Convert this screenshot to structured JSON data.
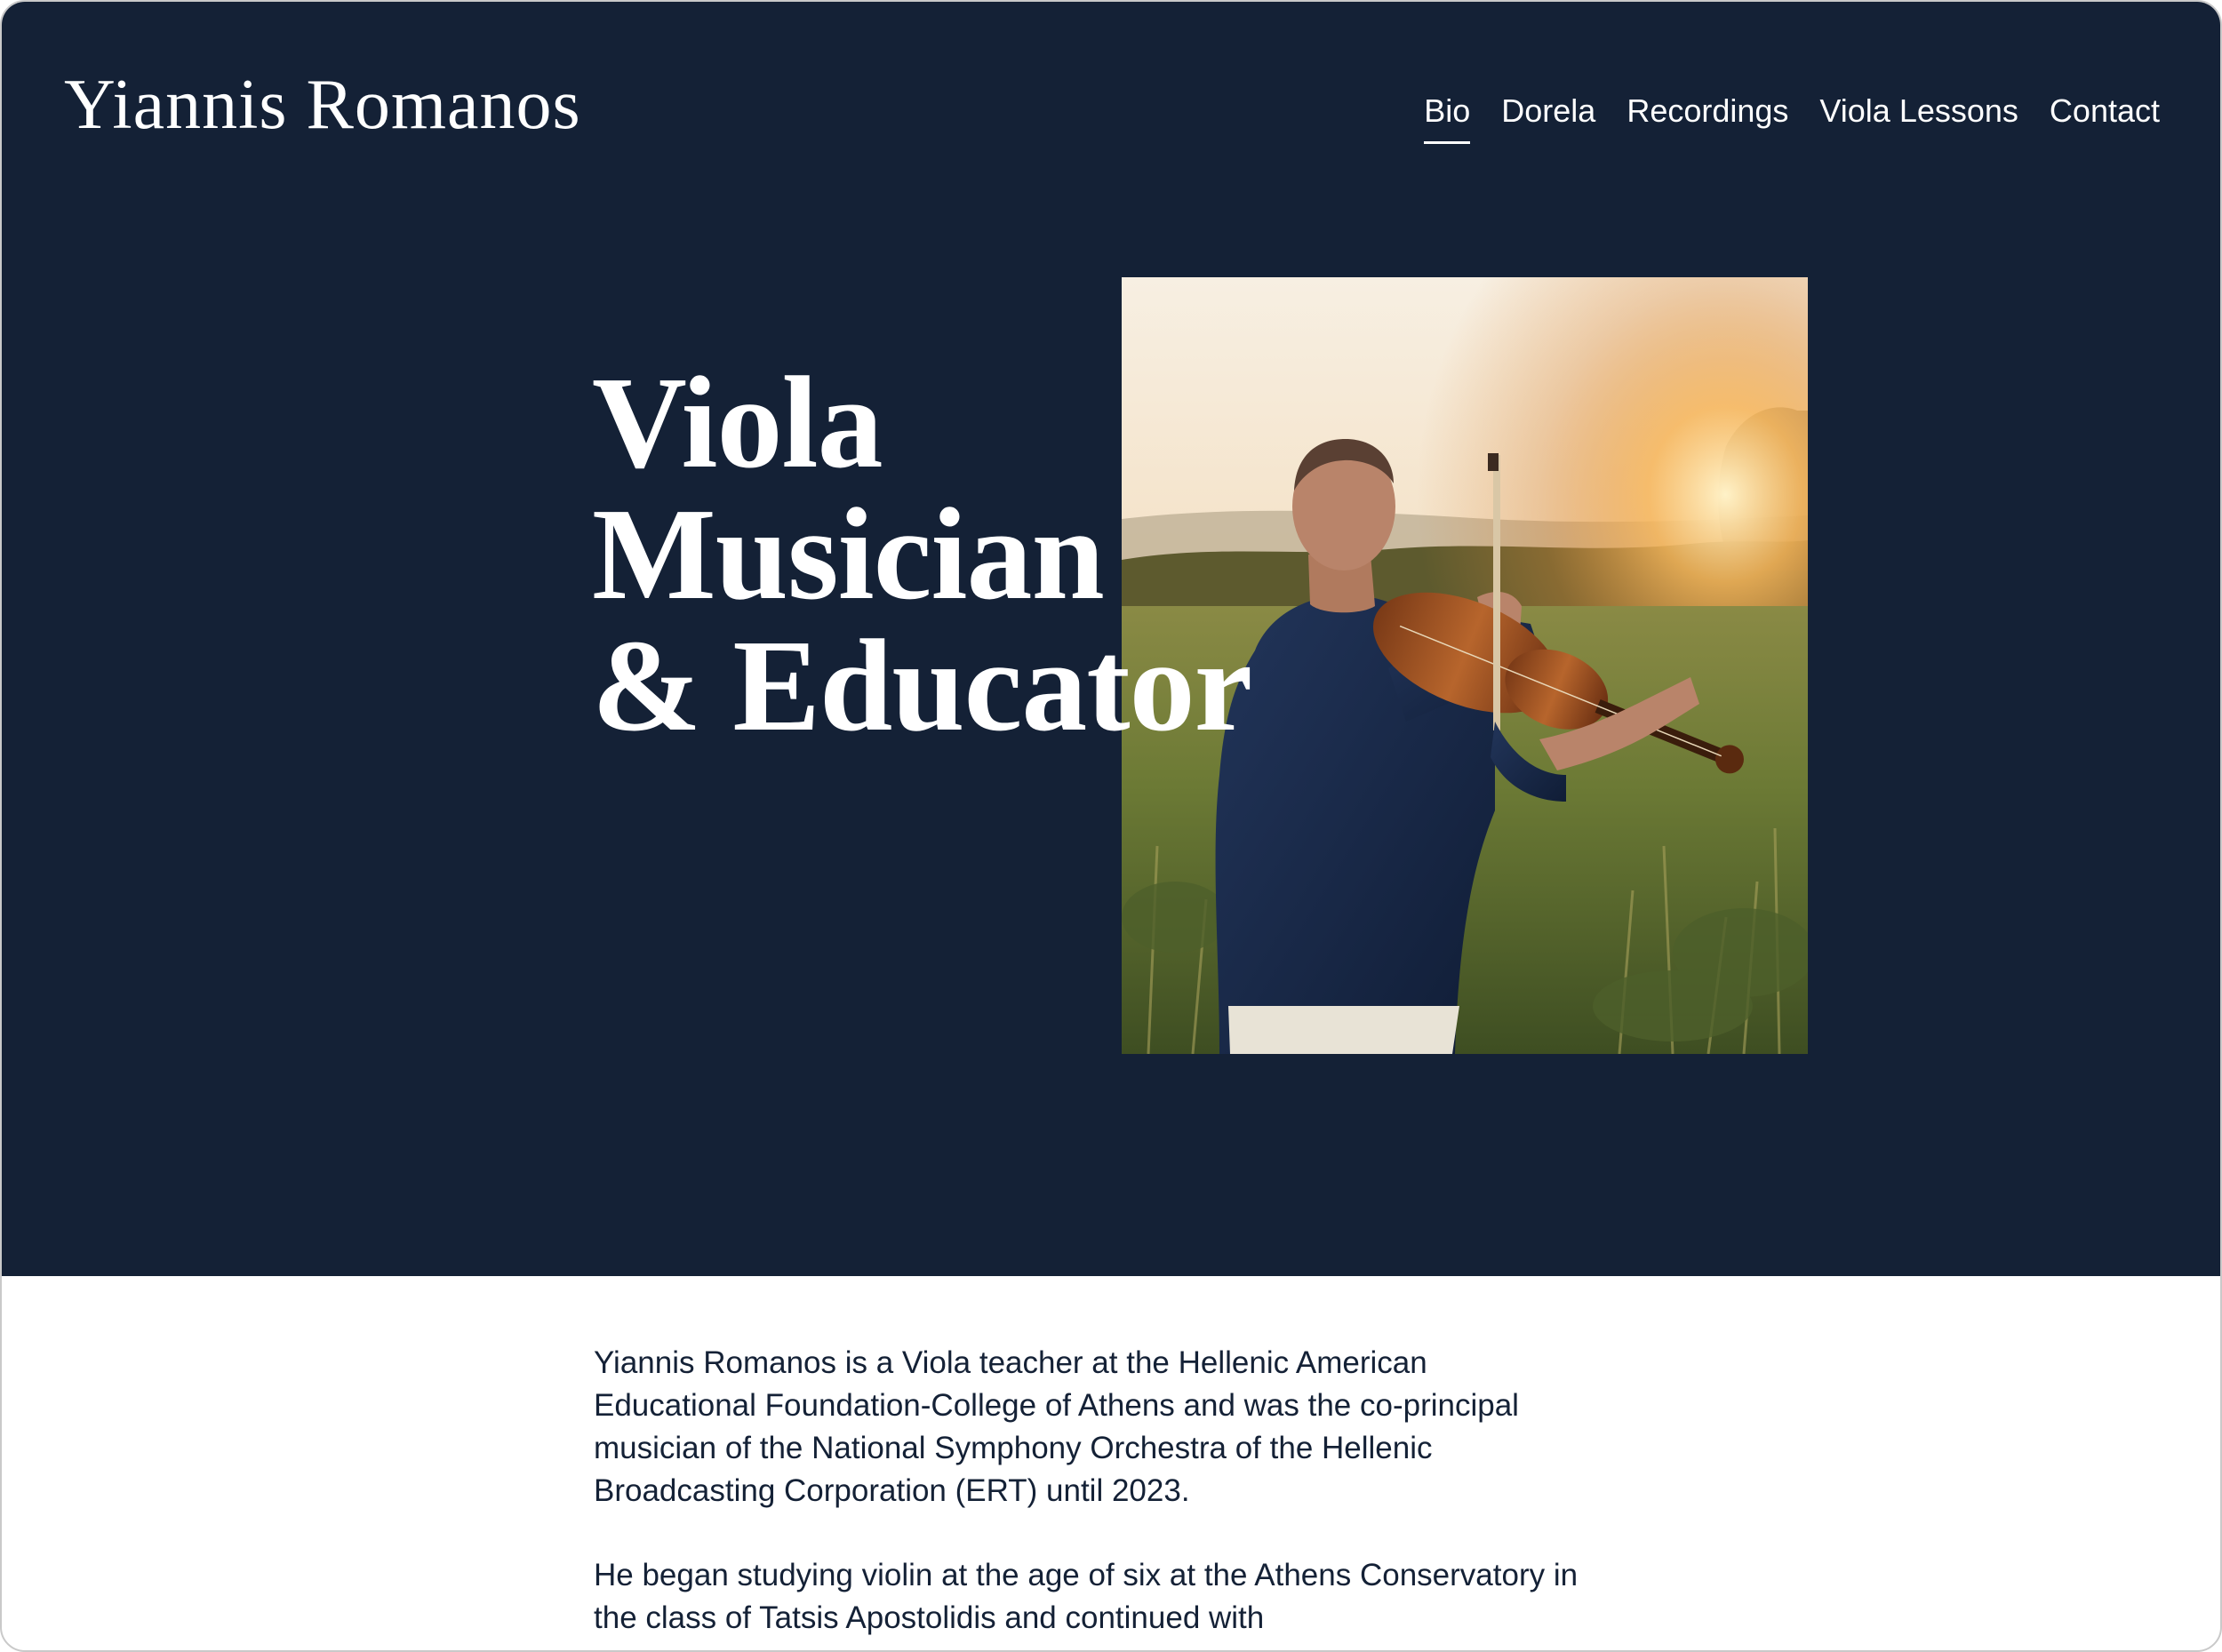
{
  "header": {
    "site_title": "Yiannis Romanos",
    "nav": [
      {
        "label": "Bio",
        "active": true
      },
      {
        "label": "Dorela",
        "active": false
      },
      {
        "label": "Recordings",
        "active": false
      },
      {
        "label": "Viola Lessons",
        "active": false
      },
      {
        "label": "Contact",
        "active": false
      }
    ]
  },
  "hero": {
    "headline_lines": [
      "Viola",
      "Musician",
      "& Educator"
    ],
    "photo_alt": "Violist playing in a meadow at sunset"
  },
  "bio": {
    "paragraphs": [
      "Yiannis Romanos is a Viola teacher at the Hellenic American Educational Foundation-College of Athens and was the co-principal musician of the National Symphony Orchestra of the Hellenic Broadcasting Corporation (ERT) until 2023.",
      "He began studying violin at the age of six at the Athens Conservatory in the class of Tatsis Apostolidis and continued with"
    ]
  },
  "colors": {
    "hero_background": "#142136",
    "text_light": "#ffffff",
    "text_dark": "#142136"
  }
}
